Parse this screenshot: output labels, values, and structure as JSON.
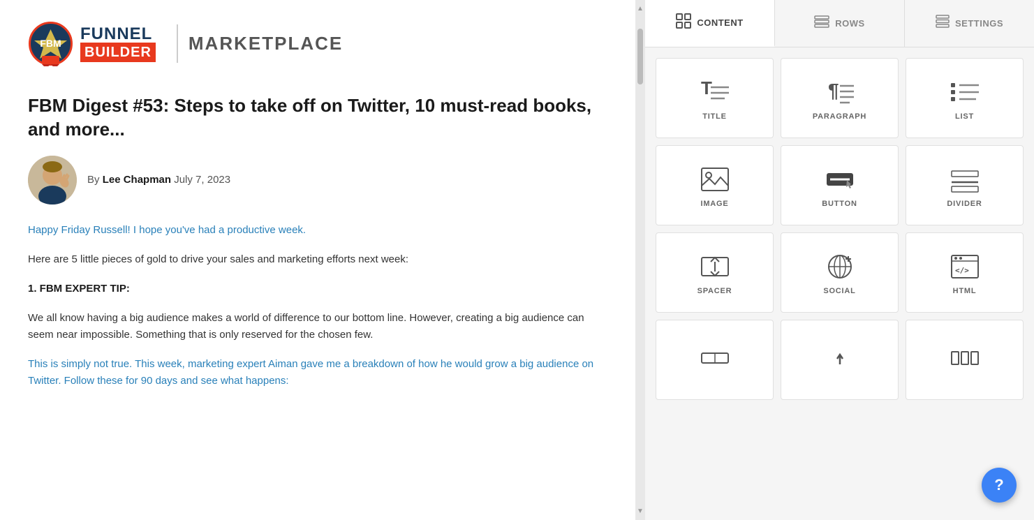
{
  "logo": {
    "funnel": "FUNNEL",
    "builder": "BUILDER",
    "divider": "|",
    "marketplace": "MARKETPLACE"
  },
  "article": {
    "title": "FBM Digest #53: Steps to take off on Twitter, 10 must-read books, and more...",
    "author_prefix": "By",
    "author_name": "Lee Chapman",
    "date": "July 7, 2023",
    "greeting": "Happy Friday Russell! I hope you've had a productive week.",
    "intro": "Here are 5 little pieces of gold to drive your sales and marketing efforts next week:",
    "section1_heading": "1. FBM EXPERT TIP:",
    "section1_body": "We all know having a big audience makes a world of difference to our bottom line. However, creating a big audience can seem near impossible. Something that is only reserved for the chosen few.",
    "section2_body": "This is simply not true. This week, marketing expert Aiman gave me a breakdown of how he would grow a big audience on Twitter. Follow these for 90 days and see what happens:"
  },
  "tabs": [
    {
      "id": "content",
      "label": "CONTENT",
      "icon": "grid"
    },
    {
      "id": "rows",
      "label": "ROWS",
      "icon": "rows"
    },
    {
      "id": "settings",
      "label": "SETTINGS",
      "icon": "settings"
    }
  ],
  "active_tab": "content",
  "grid_items": [
    {
      "id": "title",
      "label": "TITLE"
    },
    {
      "id": "paragraph",
      "label": "PARAGRAPH"
    },
    {
      "id": "list",
      "label": "LIST"
    },
    {
      "id": "image",
      "label": "IMAGE"
    },
    {
      "id": "button",
      "label": "BUTTON"
    },
    {
      "id": "divider",
      "label": "DIVIDER"
    },
    {
      "id": "spacer",
      "label": "SPACER"
    },
    {
      "id": "social",
      "label": "SOCIAL"
    },
    {
      "id": "html",
      "label": "HTML"
    },
    {
      "id": "row1",
      "label": ""
    },
    {
      "id": "row2",
      "label": ""
    },
    {
      "id": "row3",
      "label": ""
    }
  ],
  "help": {
    "label": "?"
  }
}
